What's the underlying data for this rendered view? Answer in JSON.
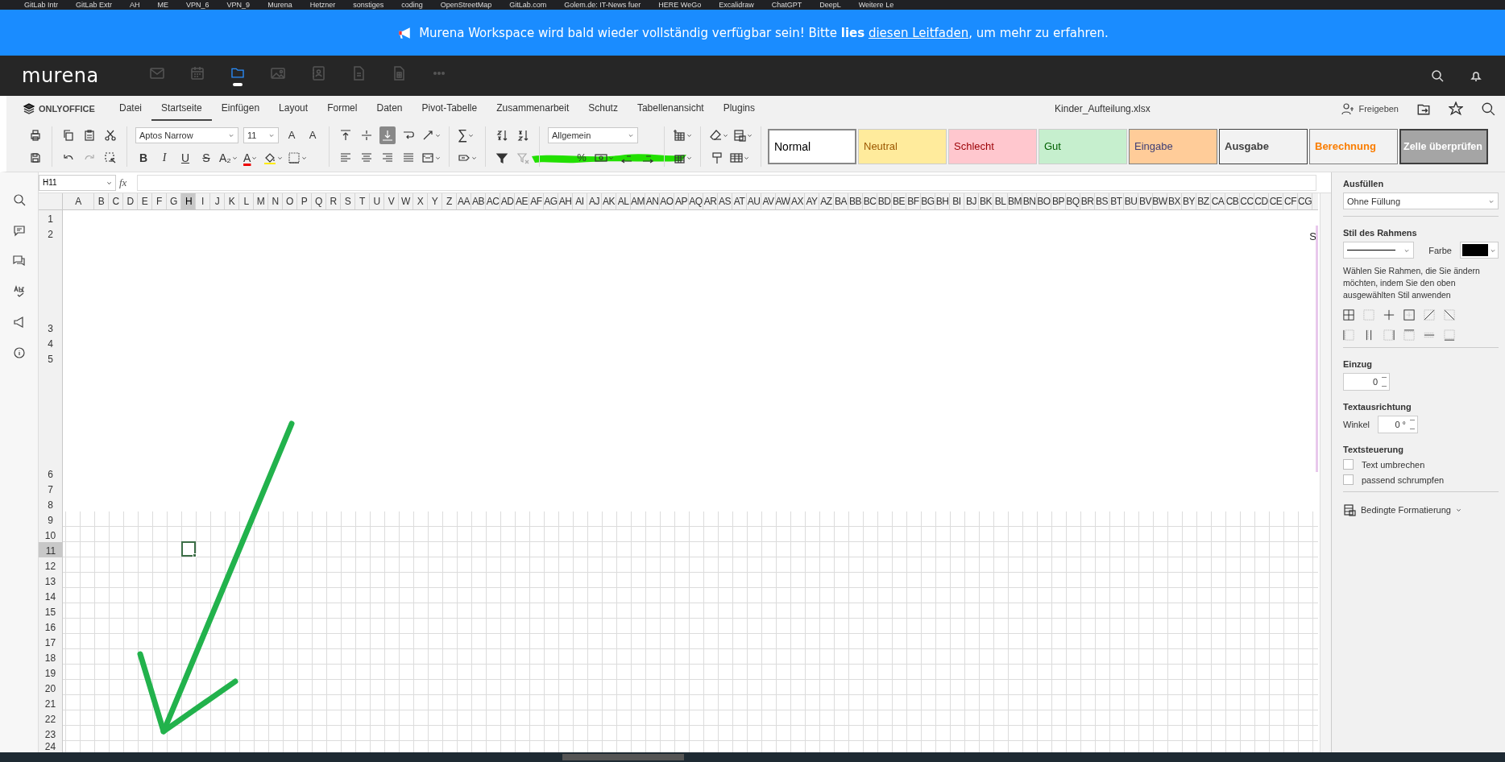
{
  "bookmarks": [
    "GitLab Intr",
    "GitLab Extr",
    "AH",
    "ME",
    "VPN_6",
    "VPN_9",
    "Murena",
    "Hetzner",
    "sonstiges",
    "coding",
    "OpenStreetMap",
    "GitLab.com",
    "Golem.de: IT-News fuer",
    "HERE WeGo",
    "Excalidraw",
    "ChatGPT",
    "DeepL",
    "Weitere Le"
  ],
  "banner": {
    "text_before": "Murena Workspace wird bald wieder vollständig verfügbar sein! Bitte **lies** ",
    "link": "diesen Leitfaden",
    "text_after": ", um mehr zu erfahren."
  },
  "murena": {
    "logo": "murena",
    "apps": [
      {
        "kind": "mail",
        "selected": false
      },
      {
        "kind": "calendar",
        "selected": false
      },
      {
        "kind": "files",
        "selected": true
      },
      {
        "kind": "photos",
        "selected": false
      },
      {
        "kind": "contacts",
        "selected": false
      },
      {
        "kind": "notes",
        "selected": false
      },
      {
        "kind": "sheet",
        "selected": false
      },
      {
        "kind": "more",
        "selected": false
      }
    ]
  },
  "editor": {
    "brand": "ONLYOFFICE",
    "tabs": [
      {
        "label": "Datei",
        "selected": false
      },
      {
        "label": "Startseite",
        "selected": true
      },
      {
        "label": "Einfügen",
        "selected": false
      },
      {
        "label": "Layout",
        "selected": false
      },
      {
        "label": "Formel",
        "selected": false
      },
      {
        "label": "Daten",
        "selected": false
      },
      {
        "label": "Pivot-Tabelle",
        "selected": false
      },
      {
        "label": "Zusammenarbeit",
        "selected": false
      },
      {
        "label": "Schutz",
        "selected": false
      },
      {
        "label": "Tabellenansicht",
        "selected": false
      },
      {
        "label": "Plugins",
        "selected": false
      }
    ],
    "file_name": "Kinder_Aufteilung.xlsx",
    "share_label": "Freigeben"
  },
  "toolbar": {
    "font": "Aptos Narrow",
    "font_size": "11",
    "grow": "A",
    "shrink": "A",
    "format_buttons": [
      {
        "label": "B",
        "kind": "bold"
      },
      {
        "label": "I",
        "kind": "italic"
      },
      {
        "label": "U",
        "kind": "underline"
      },
      {
        "label": "S",
        "kind": "strike"
      }
    ],
    "subscript": "A₂",
    "font_color": "A",
    "sum": "∑",
    "number_format": "Allgemein",
    "percent": "%",
    "cell_styles": [
      {
        "label": "Normal",
        "kind": "normal"
      },
      {
        "label": "Neutral",
        "kind": "neutral"
      },
      {
        "label": "Schlecht",
        "kind": "bad"
      },
      {
        "label": "Gut",
        "kind": "good"
      },
      {
        "label": "Eingabe",
        "kind": "input"
      },
      {
        "label": "Ausgabe",
        "kind": "output"
      },
      {
        "label": "Berechnung",
        "kind": "calculation"
      },
      {
        "label": "Zelle überprüfen",
        "kind": "check"
      }
    ]
  },
  "formula_bar": {
    "cell": "H11",
    "fx": "fx"
  },
  "sheet": {
    "object_label": "S",
    "columns": [
      {
        "label": "A",
        "selected": false
      },
      {
        "label": "B",
        "selected": false
      },
      {
        "label": "C",
        "selected": false
      },
      {
        "label": "D",
        "selected": false
      },
      {
        "label": "E",
        "selected": false
      },
      {
        "label": "F",
        "selected": false
      },
      {
        "label": "G",
        "selected": false
      },
      {
        "label": "H",
        "selected": true
      },
      {
        "label": "I",
        "selected": false
      },
      {
        "label": "J",
        "selected": false
      },
      {
        "label": "K",
        "selected": false
      },
      {
        "label": "L",
        "selected": false
      },
      {
        "label": "M",
        "selected": false
      },
      {
        "label": "N",
        "selected": false
      },
      {
        "label": "O",
        "selected": false
      },
      {
        "label": "P",
        "selected": false
      },
      {
        "label": "Q",
        "selected": false
      },
      {
        "label": "R",
        "selected": false
      },
      {
        "label": "S",
        "selected": false
      },
      {
        "label": "T",
        "selected": false
      },
      {
        "label": "U",
        "selected": false
      },
      {
        "label": "V",
        "selected": false
      },
      {
        "label": "W",
        "selected": false
      },
      {
        "label": "X",
        "selected": false
      },
      {
        "label": "Y",
        "selected": false
      },
      {
        "label": "Z",
        "selected": false
      },
      {
        "label": "AA",
        "selected": false
      },
      {
        "label": "AB",
        "selected": false
      },
      {
        "label": "AC",
        "selected": false
      },
      {
        "label": "AD",
        "selected": false
      },
      {
        "label": "AE",
        "selected": false
      },
      {
        "label": "AF",
        "selected": false
      },
      {
        "label": "AG",
        "selected": false
      },
      {
        "label": "AH",
        "selected": false
      },
      {
        "label": "AI",
        "selected": false
      },
      {
        "label": "AJ",
        "selected": false
      },
      {
        "label": "AK",
        "selected": false
      },
      {
        "label": "AL",
        "selected": false
      },
      {
        "label": "AM",
        "selected": false
      },
      {
        "label": "AN",
        "selected": false
      },
      {
        "label": "AO",
        "selected": false
      },
      {
        "label": "AP",
        "selected": false
      },
      {
        "label": "AQ",
        "selected": false
      },
      {
        "label": "AR",
        "selected": false
      },
      {
        "label": "AS",
        "selected": false
      },
      {
        "label": "AT",
        "selected": false
      },
      {
        "label": "AU",
        "selected": false
      },
      {
        "label": "AV",
        "selected": false
      },
      {
        "label": "AW",
        "selected": false
      },
      {
        "label": "AX",
        "selected": false
      },
      {
        "label": "AY",
        "selected": false
      },
      {
        "label": "AZ",
        "selected": false
      },
      {
        "label": "BA",
        "selected": false
      },
      {
        "label": "BB",
        "selected": false
      },
      {
        "label": "BC",
        "selected": false
      },
      {
        "label": "BD",
        "selected": false
      },
      {
        "label": "BE",
        "selected": false
      },
      {
        "label": "BF",
        "selected": false
      },
      {
        "label": "BG",
        "selected": false
      },
      {
        "label": "BH",
        "selected": false
      },
      {
        "label": "BI",
        "selected": false
      },
      {
        "label": "BJ",
        "selected": false
      },
      {
        "label": "BK",
        "selected": false
      },
      {
        "label": "BL",
        "selected": false
      },
      {
        "label": "BM",
        "selected": false
      },
      {
        "label": "BN",
        "selected": false
      },
      {
        "label": "BO",
        "selected": false
      },
      {
        "label": "BP",
        "selected": false
      },
      {
        "label": "BQ",
        "selected": false
      },
      {
        "label": "BR",
        "selected": false
      },
      {
        "label": "BS",
        "selected": false
      },
      {
        "label": "BT",
        "selected": false
      },
      {
        "label": "BU",
        "selected": false
      },
      {
        "label": "BV",
        "selected": false
      },
      {
        "label": "BW",
        "selected": false
      },
      {
        "label": "BX",
        "selected": false
      },
      {
        "label": "BY",
        "selected": false
      },
      {
        "label": "BZ",
        "selected": false
      },
      {
        "label": "CA",
        "selected": false
      },
      {
        "label": "CB",
        "selected": false
      },
      {
        "label": "CC",
        "selected": false
      },
      {
        "label": "CD",
        "selected": false
      },
      {
        "label": "CE",
        "selected": false
      },
      {
        "label": "CF",
        "selected": false
      },
      {
        "label": "CG",
        "selected": false
      }
    ],
    "rows": [
      {
        "label": "1",
        "kind": "blank",
        "selected": false
      },
      {
        "label": "2",
        "kind": "blank",
        "selected": false
      },
      {
        "label": "3",
        "kind": "tall",
        "selected": false
      },
      {
        "label": "4",
        "kind": "blank",
        "selected": false
      },
      {
        "label": "5",
        "kind": "blank",
        "selected": false
      },
      {
        "label": "6",
        "kind": "taller",
        "selected": false
      },
      {
        "label": "7",
        "kind": "blank",
        "selected": false
      },
      {
        "label": "8",
        "kind": "blank",
        "selected": false
      },
      {
        "label": "9",
        "kind": "grid",
        "selected": false
      },
      {
        "label": "10",
        "kind": "grid",
        "selected": false
      },
      {
        "label": "11",
        "kind": "grid",
        "selected": true
      },
      {
        "label": "12",
        "kind": "grid",
        "selected": false
      },
      {
        "label": "13",
        "kind": "grid",
        "selected": false
      },
      {
        "label": "14",
        "kind": "grid",
        "selected": false
      },
      {
        "label": "15",
        "kind": "grid",
        "selected": false
      },
      {
        "label": "16",
        "kind": "grid",
        "selected": false
      },
      {
        "label": "17",
        "kind": "grid",
        "selected": false
      },
      {
        "label": "18",
        "kind": "grid",
        "selected": false
      },
      {
        "label": "19",
        "kind": "grid",
        "selected": false
      },
      {
        "label": "20",
        "kind": "grid",
        "selected": false
      },
      {
        "label": "21",
        "kind": "grid",
        "selected": false
      },
      {
        "label": "22",
        "kind": "grid",
        "selected": false
      },
      {
        "label": "23",
        "kind": "grid",
        "selected": false
      },
      {
        "label": "24",
        "kind": "short",
        "selected": false
      }
    ]
  },
  "panel": {
    "fill_title": "Ausfüllen",
    "fill_value": "Ohne Füllung",
    "border_title": "Stil des Rahmens",
    "color_label": "Farbe",
    "border_swatch": {
      "color": "#000000"
    },
    "border_hint": "Wählen Sie Rahmen, die Sie ändern möchten, indem Sie den oben ausgewählten Stil anwenden",
    "indent_title": "Einzug",
    "indent_value": "0",
    "orientation_title": "Textausrichtung",
    "angle_label": "Winkel",
    "angle_value": "0 °",
    "control_title": "Textsteuerung",
    "checks": [
      {
        "label": "Text umbrechen",
        "checked": false
      },
      {
        "label": "passend schrumpfen",
        "checked": false
      }
    ],
    "conditional": "Bedingte Formatierung"
  }
}
